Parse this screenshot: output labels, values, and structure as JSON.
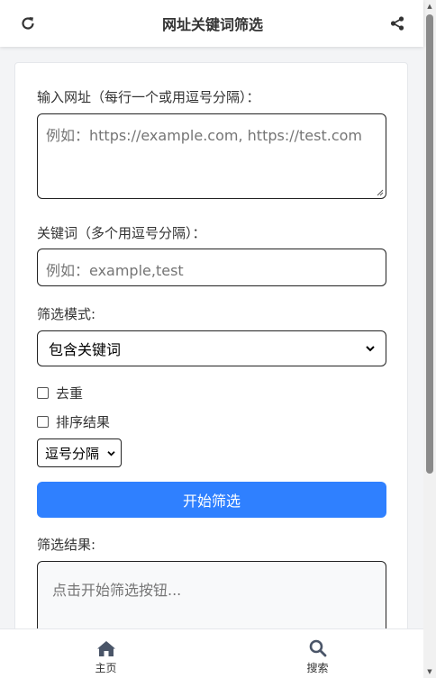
{
  "header": {
    "title": "网址关键词筛选",
    "refresh_icon": "refresh-icon",
    "share_icon": "share-icon"
  },
  "form": {
    "urls_label": "输入网址（每行一个或用逗号分隔）：",
    "urls_placeholder": "例如：https://example.com, https://test.com",
    "keywords_label": "关键词（多个用逗号分隔）：",
    "keywords_placeholder": "例如：example,test",
    "mode_label": "筛选模式:",
    "mode_selected": "包含关键词",
    "dedupe_label": "去重",
    "sort_label": "排序结果",
    "separator_selected": "逗号分隔",
    "submit_label": "开始筛选",
    "result_label": "筛选结果:",
    "result_placeholder": "点击开始筛选按钮..."
  },
  "bottom_nav": {
    "items": [
      {
        "label": "主页",
        "icon": "home-icon"
      },
      {
        "label": "搜索",
        "icon": "search-icon"
      }
    ]
  },
  "colors": {
    "primary": "#2f80ff",
    "text": "#333333",
    "placeholder": "#757575"
  }
}
